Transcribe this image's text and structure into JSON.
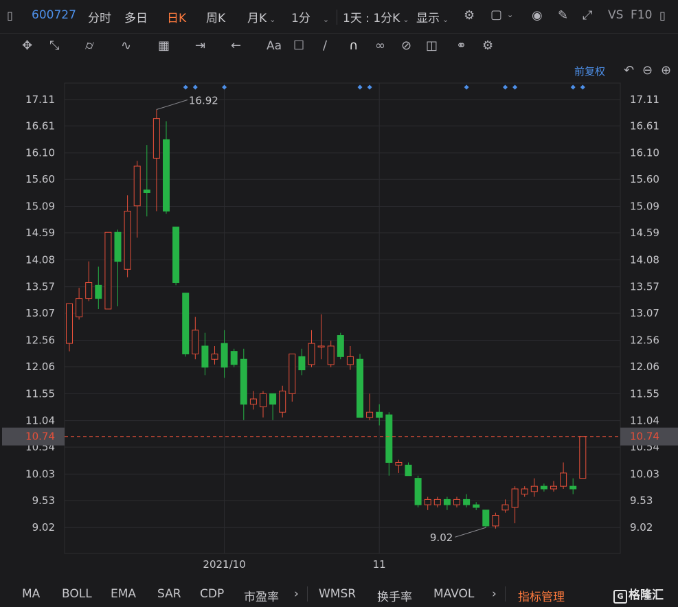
{
  "toolbar": {
    "symbol": "600727",
    "periods": [
      "分时",
      "多日",
      "日K",
      "周K",
      "月K"
    ],
    "active_period": "日K",
    "minute": "1分",
    "range": "1天 : 1分K",
    "display": "显示",
    "vs": "VS",
    "f10": "F10"
  },
  "adjust_label": "前复权",
  "price_line": {
    "value": "10.74",
    "color": "#e8503a"
  },
  "colors": {
    "up": "#e8503a",
    "down": "#26b346",
    "grid": "#2c2c30",
    "axis_text": "#c8c8cc"
  },
  "bottom_tabs": [
    "MA",
    "BOLL",
    "EMA",
    "SAR",
    "CDP",
    "市盈率",
    "WMSR",
    "换手率",
    "MAVOL",
    "指标管理"
  ],
  "logo_text": "格隆汇",
  "chart_data": {
    "type": "candlestick",
    "title": "",
    "x_ticks": [
      "2021/10",
      "11"
    ],
    "y_ticks": [
      17.11,
      16.61,
      16.1,
      15.6,
      15.09,
      14.59,
      14.08,
      13.57,
      13.07,
      12.56,
      12.06,
      11.55,
      11.04,
      10.54,
      10.03,
      9.53,
      9.02
    ],
    "ylim": [
      8.53,
      17.42
    ],
    "annotations": [
      {
        "label": "16.92",
        "index": 9
      },
      {
        "label": "9.02",
        "index": 43
      }
    ],
    "markers": [
      12,
      13,
      16,
      30,
      31,
      41,
      45,
      46,
      52,
      53
    ],
    "tick_index": {
      "2021/10": 16,
      "11": 32
    },
    "candles": [
      {
        "o": 12.5,
        "h": 12.7,
        "l": 12.35,
        "c": 13.25
      },
      {
        "o": 13.0,
        "h": 13.55,
        "l": 12.95,
        "c": 13.35
      },
      {
        "o": 13.35,
        "h": 14.05,
        "l": 13.3,
        "c": 13.65
      },
      {
        "o": 13.6,
        "h": 13.95,
        "l": 13.15,
        "c": 13.35
      },
      {
        "o": 13.15,
        "h": 14.2,
        "l": 13.15,
        "c": 14.6
      },
      {
        "o": 14.6,
        "h": 14.65,
        "l": 13.2,
        "c": 14.05
      },
      {
        "o": 13.9,
        "h": 15.3,
        "l": 13.75,
        "c": 15.0
      },
      {
        "o": 15.1,
        "h": 15.95,
        "l": 14.5,
        "c": 15.85
      },
      {
        "o": 15.4,
        "h": 16.25,
        "l": 14.9,
        "c": 15.35
      },
      {
        "o": 16.0,
        "h": 16.92,
        "l": 15.0,
        "c": 16.75
      },
      {
        "o": 16.35,
        "h": 16.7,
        "l": 14.95,
        "c": 15.0
      },
      {
        "o": 14.7,
        "h": 14.7,
        "l": 13.6,
        "c": 13.65
      },
      {
        "o": 13.45,
        "h": 13.45,
        "l": 12.25,
        "c": 12.3
      },
      {
        "o": 12.3,
        "h": 13.0,
        "l": 12.2,
        "c": 12.75
      },
      {
        "o": 12.45,
        "h": 12.7,
        "l": 11.9,
        "c": 12.05
      },
      {
        "o": 12.2,
        "h": 12.45,
        "l": 12.1,
        "c": 12.3
      },
      {
        "o": 12.5,
        "h": 12.75,
        "l": 11.85,
        "c": 12.05
      },
      {
        "o": 12.35,
        "h": 12.4,
        "l": 12.05,
        "c": 12.1
      },
      {
        "o": 12.2,
        "h": 12.4,
        "l": 11.05,
        "c": 11.35
      },
      {
        "o": 11.35,
        "h": 11.6,
        "l": 11.25,
        "c": 11.45
      },
      {
        "o": 11.3,
        "h": 11.6,
        "l": 11.1,
        "c": 11.55
      },
      {
        "o": 11.55,
        "h": 11.55,
        "l": 11.05,
        "c": 11.35
      },
      {
        "o": 11.2,
        "h": 11.7,
        "l": 11.1,
        "c": 11.6
      },
      {
        "o": 11.55,
        "h": 12.3,
        "l": 11.4,
        "c": 12.3
      },
      {
        "o": 12.25,
        "h": 12.4,
        "l": 11.9,
        "c": 12.0
      },
      {
        "o": 12.1,
        "h": 12.75,
        "l": 12.05,
        "c": 12.5
      },
      {
        "o": 12.45,
        "h": 13.05,
        "l": 12.2,
        "c": 12.45
      },
      {
        "o": 12.1,
        "h": 12.55,
        "l": 12.05,
        "c": 12.45
      },
      {
        "o": 12.65,
        "h": 12.7,
        "l": 12.2,
        "c": 12.25
      },
      {
        "o": 12.1,
        "h": 12.45,
        "l": 12.0,
        "c": 12.25
      },
      {
        "o": 12.2,
        "h": 12.3,
        "l": 11.1,
        "c": 11.1
      },
      {
        "o": 11.1,
        "h": 11.55,
        "l": 11.05,
        "c": 11.2
      },
      {
        "o": 11.2,
        "h": 11.35,
        "l": 10.95,
        "c": 11.1
      },
      {
        "o": 11.15,
        "h": 11.2,
        "l": 10.0,
        "c": 10.25
      },
      {
        "o": 10.2,
        "h": 10.3,
        "l": 10.05,
        "c": 10.25
      },
      {
        "o": 10.2,
        "h": 10.25,
        "l": 10.05,
        "c": 10.0
      },
      {
        "o": 9.95,
        "h": 10.0,
        "l": 9.4,
        "c": 9.45
      },
      {
        "o": 9.45,
        "h": 9.6,
        "l": 9.35,
        "c": 9.55
      },
      {
        "o": 9.45,
        "h": 9.6,
        "l": 9.4,
        "c": 9.55
      },
      {
        "o": 9.55,
        "h": 9.6,
        "l": 9.35,
        "c": 9.45
      },
      {
        "o": 9.45,
        "h": 9.6,
        "l": 9.4,
        "c": 9.55
      },
      {
        "o": 9.55,
        "h": 9.65,
        "l": 9.4,
        "c": 9.45
      },
      {
        "o": 9.45,
        "h": 9.5,
        "l": 9.35,
        "c": 9.4
      },
      {
        "o": 9.35,
        "h": 9.35,
        "l": 9.02,
        "c": 9.05
      },
      {
        "o": 9.05,
        "h": 9.3,
        "l": 9.0,
        "c": 9.25
      },
      {
        "o": 9.35,
        "h": 9.55,
        "l": 9.3,
        "c": 9.45
      },
      {
        "o": 9.4,
        "h": 9.8,
        "l": 9.1,
        "c": 9.75
      },
      {
        "o": 9.65,
        "h": 9.8,
        "l": 9.6,
        "c": 9.75
      },
      {
        "o": 9.7,
        "h": 9.95,
        "l": 9.6,
        "c": 9.8
      },
      {
        "o": 9.8,
        "h": 9.85,
        "l": 9.7,
        "c": 9.75
      },
      {
        "o": 9.75,
        "h": 9.9,
        "l": 9.7,
        "c": 9.8
      },
      {
        "o": 9.8,
        "h": 10.25,
        "l": 9.75,
        "c": 10.05
      },
      {
        "o": 9.8,
        "h": 9.95,
        "l": 9.65,
        "c": 9.75
      },
      {
        "o": 9.95,
        "h": 10.74,
        "l": 9.95,
        "c": 10.74
      }
    ]
  }
}
